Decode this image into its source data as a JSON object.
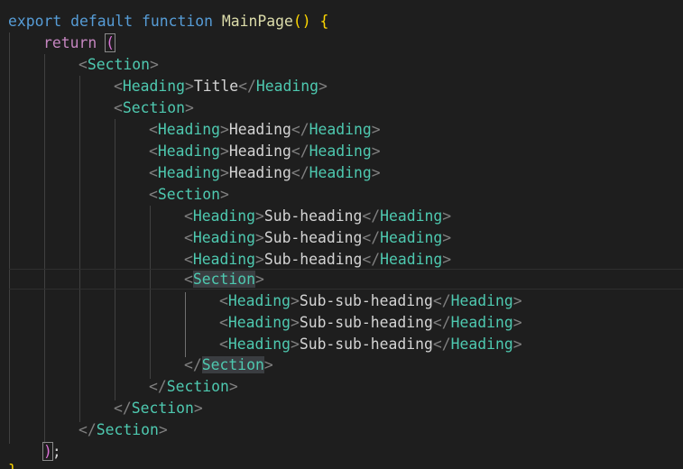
{
  "editor": {
    "language": "jsx",
    "colors": {
      "background": "#1e1e1e",
      "keyword_control": "#c586c0",
      "keyword": "#569cd6",
      "function": "#dcdcaa",
      "component_tag": "#4ec9b0",
      "tag_bracket": "#808080",
      "text": "#d4d4d4",
      "brace": "#ffd700",
      "paren": "#da70d6"
    },
    "code": {
      "export_kw": "export",
      "default_kw": "default",
      "function_kw": "function",
      "fn_name": "MainPage",
      "fn_parens": "()",
      "open_brace": "{",
      "return_kw": "return",
      "open_paren": "(",
      "close_paren": ")",
      "semicolon": ";",
      "close_brace": "}",
      "lt": "<",
      "gt": ">",
      "lt_slash": "</",
      "section_tag": "Section",
      "heading_tag": "Heading",
      "title_text": "Title",
      "heading_text": "Heading",
      "subheading_text": "Sub-heading",
      "subsubheading_text": "Sub-sub-heading"
    }
  }
}
